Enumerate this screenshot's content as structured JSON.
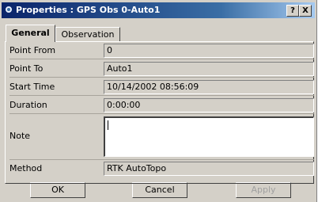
{
  "window": {
    "title": "Properties : GPS Obs 0-Auto1",
    "help_label": "?",
    "close_label": "X"
  },
  "tabs": [
    {
      "label": "General",
      "active": true
    },
    {
      "label": "Observation",
      "active": false
    }
  ],
  "fields": {
    "point_from": {
      "label": "Point From",
      "value": "0"
    },
    "point_to": {
      "label": "Point To",
      "value": "Auto1"
    },
    "start_time": {
      "label": "Start Time",
      "value": "10/14/2002 08:56:09"
    },
    "duration": {
      "label": "Duration",
      "value": "0:00:00"
    },
    "note": {
      "label": "Note",
      "value": ""
    },
    "method": {
      "label": "Method",
      "value": "RTK AutoTopo"
    }
  },
  "buttons": {
    "ok": "OK",
    "cancel": "Cancel",
    "apply": "Apply"
  },
  "colors": {
    "title_bar_start": "#0a246a",
    "title_bar_end": "#a6caf0",
    "face": "#d4d0c8"
  }
}
